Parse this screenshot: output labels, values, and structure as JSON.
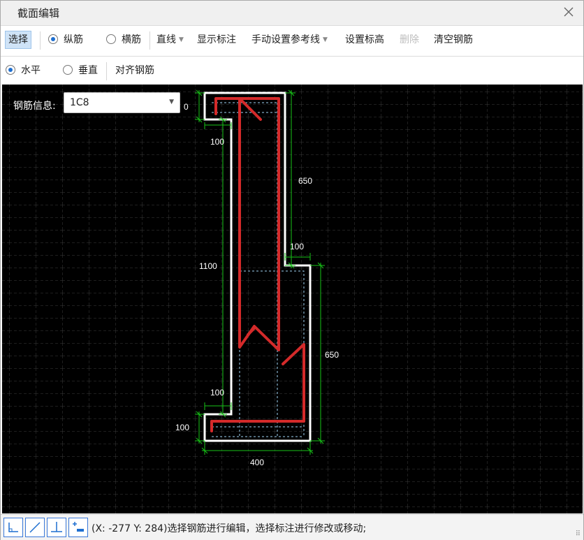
{
  "window": {
    "title": "截面编辑"
  },
  "toolbar1": {
    "select": "选择",
    "longitudinal": "纵筋",
    "transverse": "横筋",
    "line_mode": "直线",
    "show_dims": "显示标注",
    "manual_ref": "手动设置参考线",
    "set_elevation": "设置标高",
    "delete": "删除",
    "clear_rebar": "清空钢筋"
  },
  "toolbar2": {
    "horizontal": "水平",
    "vertical": "垂直",
    "align_rebar": "对齐钢筋"
  },
  "rebar_info": {
    "label": "钢筋信息:",
    "value": "1C8"
  },
  "dimensions": {
    "top_left_partial": "0",
    "top_flange_width": "100",
    "upper_right_height": "650",
    "step_width": "100",
    "left_height": "1100",
    "lower_right_height": "650",
    "bottom_step_width": "100",
    "bottom_flange_height": "100",
    "total_width": "400"
  },
  "status": {
    "text": "(X: -277 Y: 284)选择钢筋进行编辑，选择标注进行修改或移动;"
  },
  "colors": {
    "accent": "#1e6fd0",
    "rebar": "#d42a2a",
    "outline": "#ffffff",
    "dimension": "#17c317",
    "canvas": "#000000"
  }
}
